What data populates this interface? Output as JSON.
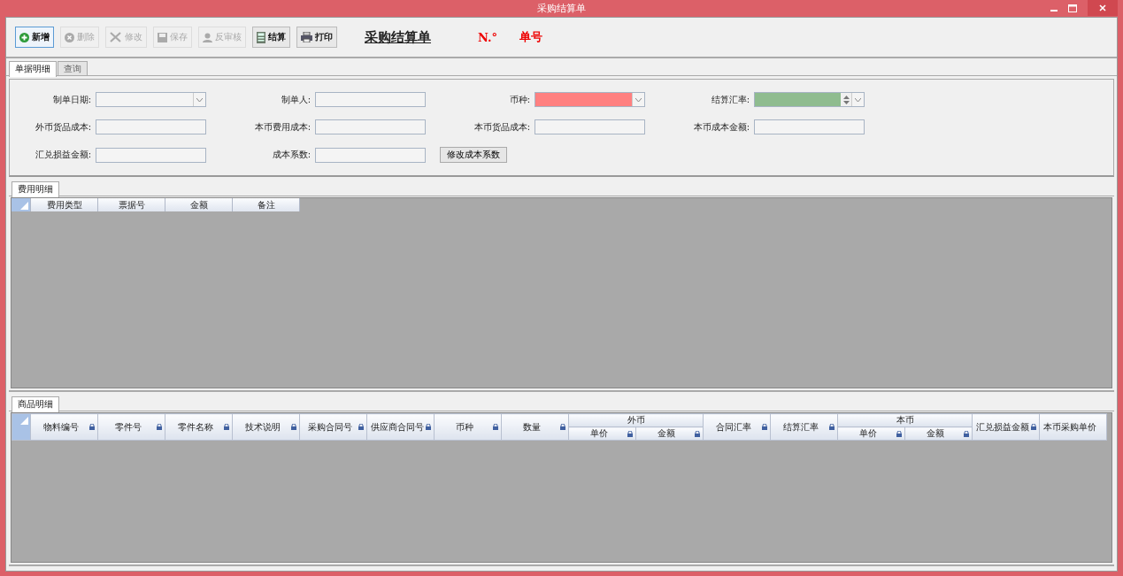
{
  "window": {
    "title": "采购结算单"
  },
  "toolbar": [
    {
      "kind": "add",
      "label": "新增",
      "disabled": false,
      "focused": true
    },
    {
      "kind": "delete",
      "label": "删除",
      "disabled": true,
      "focused": false
    },
    {
      "kind": "edit",
      "label": "修改",
      "disabled": true,
      "focused": false
    },
    {
      "kind": "save",
      "label": "保存",
      "disabled": true,
      "focused": false
    },
    {
      "kind": "unaudit",
      "label": "反审核",
      "disabled": true,
      "focused": false
    },
    {
      "kind": "settle",
      "label": "结算",
      "disabled": false,
      "focused": false
    },
    {
      "kind": "print",
      "label": "打印",
      "disabled": false,
      "focused": false
    }
  ],
  "heading": {
    "title": "采购结算单",
    "number_mark": "N.°",
    "number_label": "单号"
  },
  "main_tabs": [
    {
      "label": "单据明细",
      "selected": true
    },
    {
      "label": "查询",
      "selected": false
    }
  ],
  "form_rows": [
    [
      {
        "label": "制单日期:",
        "kind": "combo"
      },
      {
        "label": "制单人:",
        "kind": "text"
      },
      {
        "label": "币种:",
        "kind": "combo",
        "color": "#ff8080"
      },
      {
        "label": "结算汇率:",
        "kind": "spin",
        "color": "#8fbc8f"
      }
    ],
    [
      {
        "label": "外币货品成本:",
        "kind": "text"
      },
      {
        "label": "本币费用成本:",
        "kind": "text"
      },
      {
        "label": "本币货品成本:",
        "kind": "text"
      },
      {
        "label": "本币成本金额:",
        "kind": "text"
      }
    ],
    [
      {
        "label": "汇兑损益金额:",
        "kind": "text"
      },
      {
        "label": "成本系数:",
        "kind": "text"
      },
      {
        "label": "修改成本系数",
        "kind": "button"
      }
    ]
  ],
  "fee_section": {
    "tab": "费用明细",
    "columns": [
      "费用类型",
      "票据号",
      "金额",
      "备注"
    ]
  },
  "goods_section": {
    "tab": "商品明细",
    "columns": [
      {
        "label": "物料编号",
        "locked": true
      },
      {
        "label": "零件号",
        "locked": true
      },
      {
        "label": "零件名称",
        "locked": true
      },
      {
        "label": "技术说明",
        "locked": true
      },
      {
        "label": "采购合同号",
        "locked": true
      },
      {
        "label": "供应商合同号",
        "locked": true
      },
      {
        "label": "币种",
        "locked": true
      },
      {
        "label": "数量",
        "locked": true
      },
      {
        "label": "外币",
        "children": [
          {
            "label": "单价",
            "locked": true
          },
          {
            "label": "金额",
            "locked": true
          }
        ]
      },
      {
        "label": "合同汇率",
        "locked": true
      },
      {
        "label": "结算汇率",
        "locked": true
      },
      {
        "label": "本币",
        "children": [
          {
            "label": "单价",
            "locked": true
          },
          {
            "label": "金额",
            "locked": true
          }
        ]
      },
      {
        "label": "汇兑损益金额",
        "locked": true
      },
      {
        "label": "本币采购单价",
        "locked": false
      }
    ]
  }
}
